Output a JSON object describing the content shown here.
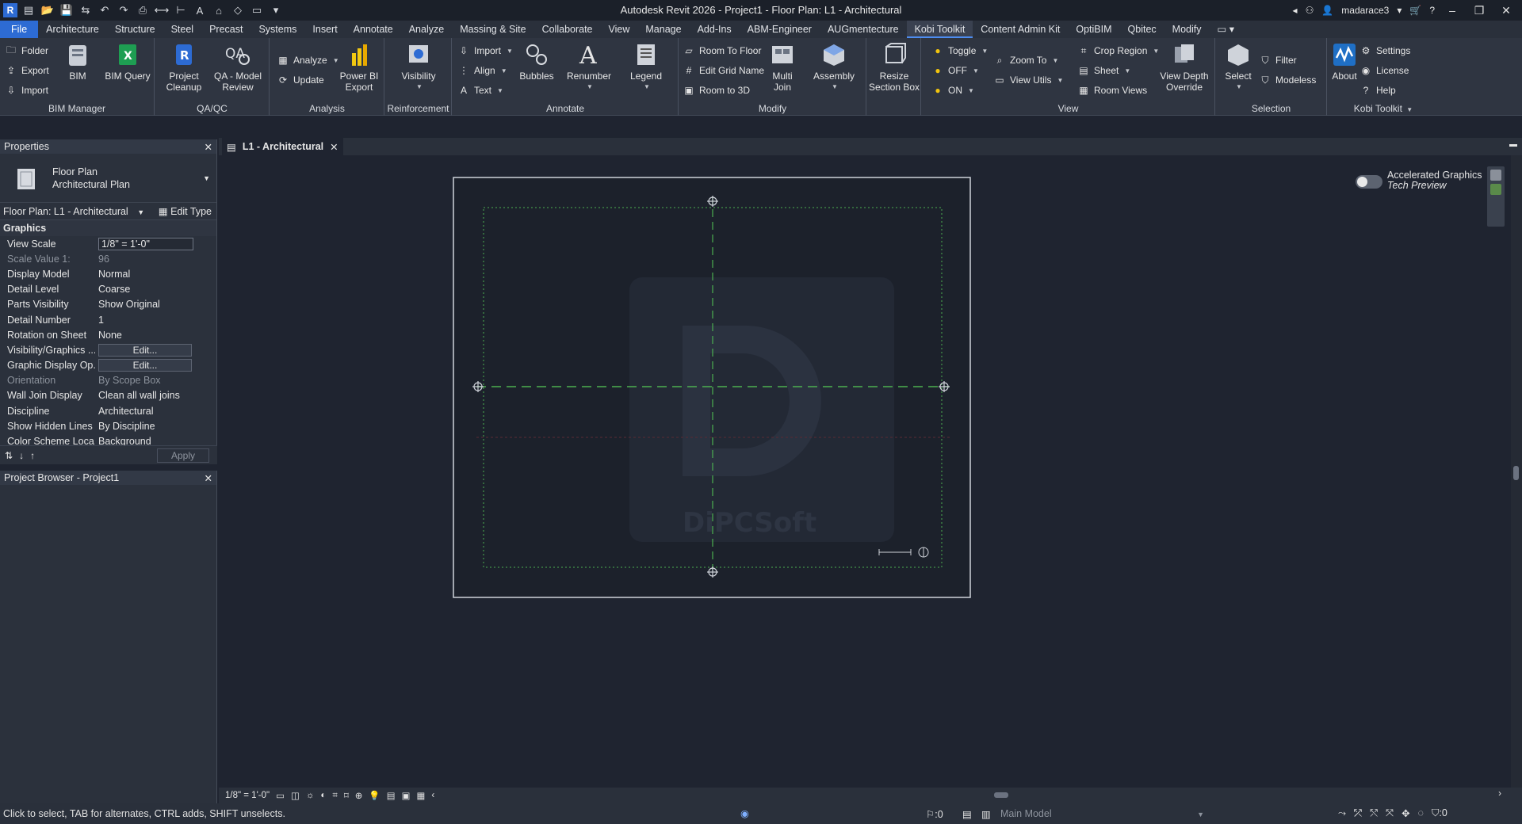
{
  "app": {
    "title": "Autodesk Revit 2026 - Project1 - Floor Plan: L1 - Architectural",
    "user": "madarace3"
  },
  "ribbon": {
    "tabs": [
      "File",
      "Architecture",
      "Structure",
      "Steel",
      "Precast",
      "Systems",
      "Insert",
      "Annotate",
      "Analyze",
      "Massing & Site",
      "Collaborate",
      "View",
      "Manage",
      "Add-Ins",
      "ABM-Engineer",
      "AUGmentecture",
      "Kobi Toolkit",
      "Content Admin Kit",
      "OptiBIM",
      "Qbitec",
      "Modify"
    ],
    "active_tab": "Kobi Toolkit",
    "panels": {
      "bim_manager": {
        "label": "BIM Manager",
        "folder": "Folder",
        "export": "Export",
        "import": "Import",
        "bim": "BIM",
        "bim_query": "BIM Query"
      },
      "qaqc": {
        "label": "QA/QC",
        "project_cleanup": "Project\nCleanup",
        "qa_model_review": "QA - Model\nReview"
      },
      "analysis": {
        "label": "Analysis",
        "analyze": "Analyze",
        "update": "Update",
        "power_bi": "Power BI\nExport"
      },
      "reinforcement": {
        "label": "Reinforcement",
        "visibility": "Visibility"
      },
      "annotate": {
        "label": "Annotate",
        "import": "Import",
        "align": "Align",
        "text": "Text",
        "bubbles": "Bubbles",
        "renumber": "Renumber",
        "legend": "Legend"
      },
      "modify": {
        "label": "Modify",
        "room_to_floor": "Room To Floor",
        "edit_grid_name": "Edit Grid Name",
        "room_to_3d": "Room to 3D",
        "multi_join": "Multi\nJoin",
        "assembly": "Assembly",
        "resize_section_box": "Resize\nSection Box"
      },
      "view": {
        "label": "View",
        "toggle": "Toggle",
        "off": "OFF",
        "on": "ON",
        "zoom_to": "Zoom To",
        "view_utils": "View Utils",
        "crop_region": "Crop Region",
        "sheet": "Sheet",
        "room_views": "Room Views",
        "view_depth_override": "View Depth\nOverride"
      },
      "selection": {
        "label": "Selection",
        "select": "Select",
        "filter": "Filter",
        "modeless": "Modeless"
      },
      "kobi": {
        "label": "Kobi Toolkit",
        "about": "About",
        "settings": "Settings",
        "license": "License",
        "help": "Help"
      }
    }
  },
  "properties": {
    "title": "Properties",
    "type_line1": "Floor Plan",
    "type_line2": "Architectural Plan",
    "instance": "Floor Plan: L1 - Architectural",
    "edit_type": "Edit Type",
    "group": "Graphics",
    "rows": [
      {
        "name": "View Scale",
        "value": "1/8\" = 1'-0\""
      },
      {
        "name": "Scale Value    1:",
        "value": "96"
      },
      {
        "name": "Display Model",
        "value": "Normal"
      },
      {
        "name": "Detail Level",
        "value": "Coarse"
      },
      {
        "name": "Parts Visibility",
        "value": "Show Original"
      },
      {
        "name": "Detail Number",
        "value": "1"
      },
      {
        "name": "Rotation on Sheet",
        "value": "None"
      },
      {
        "name": "Visibility/Graphics ...",
        "value": "Edit..."
      },
      {
        "name": "Graphic Display Op...",
        "value": "Edit..."
      },
      {
        "name": "Orientation",
        "value": "By Scope Box"
      },
      {
        "name": "Wall Join Display",
        "value": "Clean all wall joins"
      },
      {
        "name": "Discipline",
        "value": "Architectural"
      },
      {
        "name": "Show Hidden Lines",
        "value": "By Discipline"
      },
      {
        "name": "Color Scheme Loca...",
        "value": "Background"
      }
    ],
    "apply": "Apply"
  },
  "project_browser": {
    "title": "Project Browser - Project1"
  },
  "view": {
    "tab_label": "L1 - Architectural",
    "accel_line1": "Accelerated Graphics",
    "accel_line2": "Tech Preview",
    "accel_enabled": false,
    "watermark_text": "DiPCSoft",
    "scale": "1/8\" = 1'-0\""
  },
  "status": {
    "message": "Click to select, TAB for alternates, CTRL adds, SHIFT unselects.",
    "workset_count": ":0",
    "model": "Main Model",
    "filter_count": ":0"
  }
}
